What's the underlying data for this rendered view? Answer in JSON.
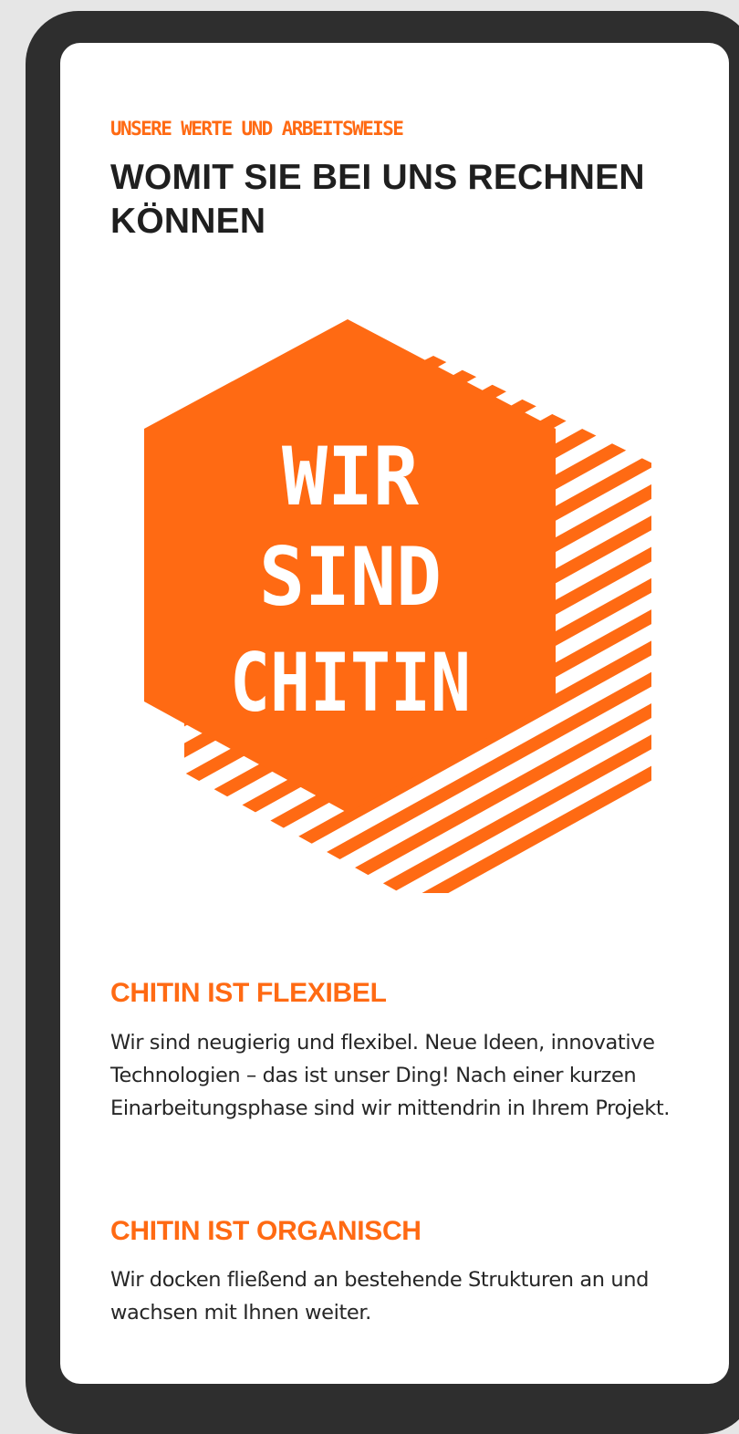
{
  "header": {
    "eyebrow": "Unsere Werte und Arbeitsweise",
    "title": "WOMIT SIE BEI UNS RECHNEN KÖNNEN"
  },
  "logo": {
    "lines": [
      "WIR",
      "SIND",
      "CHITIN"
    ],
    "accent_color": "#ff6a13"
  },
  "sections": [
    {
      "heading": "CHITIN IST FLEXIBEL",
      "body": "Wir sind neugierig und flexibel. Neue Ideen, innovative Technologien – das ist unser Ding! Nach einer kurzen Einarbeitungsphase sind wir mittendrin in Ihrem Projekt."
    },
    {
      "heading": "CHITIN IST ORGANISCH",
      "body": "Wir docken fließend an bestehende Strukturen an und wachsen mit Ihnen weiter."
    }
  ],
  "colors": {
    "accent": "#ff6a13",
    "text": "#1f1f1f",
    "frame": "#2e2e2e",
    "background": "#ffffff"
  }
}
